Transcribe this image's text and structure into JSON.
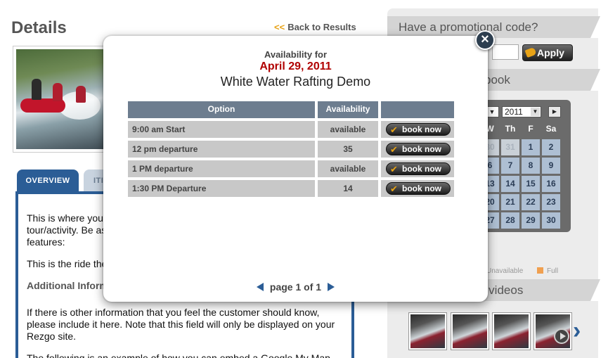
{
  "page": {
    "title": "Details",
    "back_link": "Back to Results",
    "back_arrows": "<<"
  },
  "tabs": [
    {
      "label": "OVERVIEW"
    },
    {
      "label": "ITI"
    }
  ],
  "overview": {
    "para1_line1": "This is where you",
    "para1_line2": "tour/activity. Be as",
    "para1_line3": "features:",
    "para2": "This is the ride the",
    "heading": "Additional Inform",
    "para3_line1": "If there is other information that you feel the customer should know,",
    "para3_line2": "please include it here. Note that this field will only be displayed on your",
    "para3_line3": "Rezgo site.",
    "para4": "The following is an example of how you can embed a Google My Map"
  },
  "sidebar": {
    "promo_heading": "Have a promotional code?",
    "apply_label": "Apply",
    "book_heading": "book",
    "calendar": {
      "year": "2011",
      "weekdays": [
        "W",
        "Th",
        "F",
        "Sa"
      ],
      "rows": [
        [
          "30",
          "31",
          "1",
          "2"
        ],
        [
          "6",
          "7",
          "8",
          "9"
        ],
        [
          "13",
          "14",
          "15",
          "16"
        ],
        [
          "20",
          "21",
          "22",
          "23"
        ],
        [
          "27",
          "28",
          "29",
          "30"
        ]
      ]
    },
    "legend_unavailable": "Unavailable",
    "legend_full": "Full",
    "videos_heading": "d videos",
    "thumb_next": "›"
  },
  "modal": {
    "availability_for": "Availability for",
    "date": "April 29, 2011",
    "tour_name": "White Water Rafting Demo",
    "close_label": "×",
    "columns": [
      "Option",
      "Availability",
      ""
    ],
    "rows": [
      {
        "option": "9:00 am Start",
        "availability": "available",
        "action": "book now"
      },
      {
        "option": "12 pm departure",
        "availability": "35",
        "action": "book now"
      },
      {
        "option": "1 PM departure",
        "availability": "available",
        "action": "book now"
      },
      {
        "option": "1:30 PM Departure",
        "availability": "14",
        "action": "book now"
      }
    ],
    "pager_text": "page 1 of 1"
  },
  "colors": {
    "accent_blue": "#2b5d96",
    "date_red": "#b00000",
    "arrow_orange": "#e8a317",
    "table_header": "#6d7d8f"
  }
}
